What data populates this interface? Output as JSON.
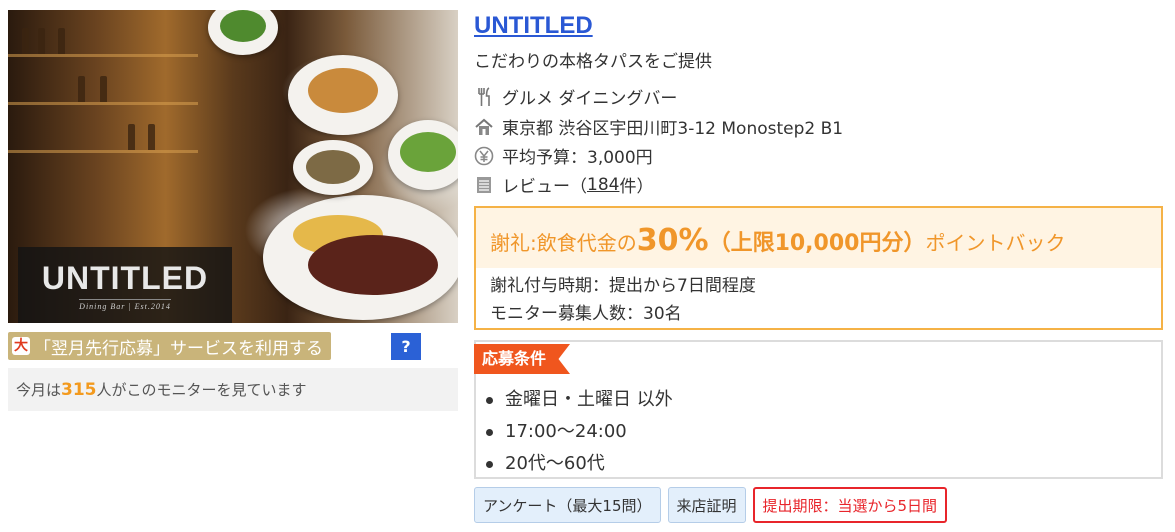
{
  "photo": {
    "logo_text": "UNTITLED",
    "logo_sub": "Dining Bar | Est.2014"
  },
  "advance_service": {
    "label": "「翌月先行応募」サービスを利用する",
    "help_label": "?"
  },
  "viewers": {
    "prefix": "今月は",
    "count": "315",
    "suffix": "人がこのモニターを見ています"
  },
  "shop": {
    "name": "UNTITLED",
    "tagline": "こだわりの本格タパスをご提供",
    "category": "グルメ ダイニングバー",
    "address": "東京都 渋谷区宇田川町3-12 Monostep2 B1",
    "budget": "平均予算：3,000円",
    "review_prefix": "レビュー（",
    "review_count": "184",
    "review_suffix": "件）"
  },
  "reward": {
    "prefix": "謝礼:飲食代金の",
    "percent": "30%",
    "limit": "（上限10,000円分）",
    "suffix": "ポイントバック",
    "timing": "謝礼付与時期：提出から7日間程度",
    "recruit": "モニター募集人数：30名"
  },
  "conditions": {
    "tag": "応募条件",
    "items": [
      "金曜日・土曜日 以外",
      "17:00～24:00",
      "20代～60代"
    ]
  },
  "tags": {
    "survey": "アンケート（最大15問）",
    "visit_proof": "来店証明",
    "deadline": "提出期限：当選から5日間"
  },
  "colors": {
    "title_link": "#2a58d4",
    "reward_orange": "#f0962a",
    "condition_tag": "#f0561e",
    "deadline_red": "#e8252b",
    "viewer_count": "#f39a1e"
  },
  "icons": [
    "cutlery-icon",
    "house-icon",
    "yen-coin-icon",
    "list-icon",
    "rocket-icon"
  ]
}
